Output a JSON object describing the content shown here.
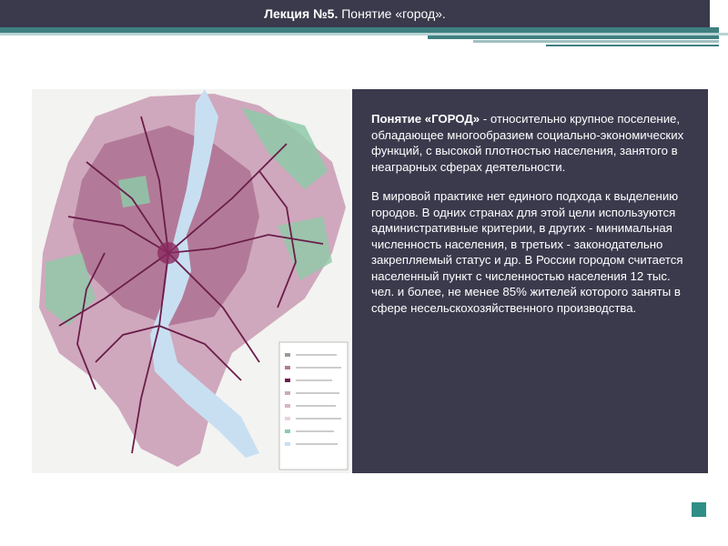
{
  "header": {
    "lecture_label": "Лекция №5.",
    "lecture_topic": " Понятие «город»."
  },
  "definition": {
    "term": "Понятие «ГОРОД»",
    "text": " -  относительно крупное поселение, обладающее многообразием социально-экономических функций, с высокой плотностью населения, занятого в неаграрных сферах деятельности."
  },
  "body_paragraph": "В мировой практике нет единого подхода к выделению городов. В одних странах для этой цели используются административные критерии, в других - минимальная численность населения, в третьих - законодательно закрепляемый статус и др. В России городом считается населенный пункт с численностью населения 12 тыс. чел. и более, не менее 85% жителей которого заняты в сфере несельскохозяйственного производства.",
  "colors": {
    "banner": "#3a3a4c",
    "teal": "#3f7f80",
    "panel": "#3b3a4d",
    "accent_square": "#2f8f86",
    "map_urban": "#b27a98",
    "map_green": "#8ec9a8",
    "map_water": "#c8dff2",
    "map_roads": "#6b1d4a"
  }
}
